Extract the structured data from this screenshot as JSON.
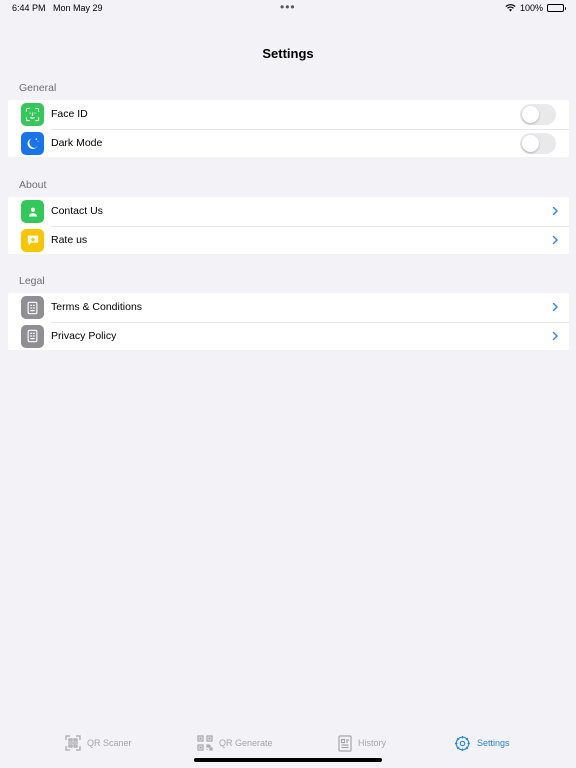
{
  "status_bar": {
    "time": "6:44 PM",
    "date": "Mon May 29",
    "battery": "100%",
    "icons": [
      "wifi-icon",
      "battery-icon"
    ]
  },
  "nav": {
    "title": "Settings"
  },
  "sections": {
    "general": {
      "header": "General",
      "items": [
        {
          "label": "Face ID",
          "icon": "face-id-icon",
          "icon_color": "#34c759",
          "control": "toggle",
          "value": "off"
        },
        {
          "label": "Dark Mode",
          "icon": "moon-icon",
          "icon_color": "#1a73e8",
          "control": "toggle",
          "value": "off"
        }
      ]
    },
    "about": {
      "header": "About",
      "items": [
        {
          "label": "Contact Us",
          "icon": "person-icon",
          "icon_color": "#34c759",
          "control": "chevron"
        },
        {
          "label": "Rate us",
          "icon": "star-bubble-icon",
          "icon_color": "#f7c600",
          "control": "chevron"
        }
      ]
    },
    "legal": {
      "header": "Legal",
      "items": [
        {
          "label": "Terms & Conditions",
          "icon": "document-icon",
          "icon_color": "#8e8e93",
          "control": "chevron"
        },
        {
          "label": "Privacy Policy",
          "icon": "document-icon",
          "icon_color": "#8e8e93",
          "control": "chevron"
        }
      ]
    }
  },
  "tab_bar": {
    "tabs": [
      {
        "label": "QR Scaner",
        "icon": "qr-scan-icon",
        "active": false
      },
      {
        "label": "QR Generate",
        "icon": "qr-code-icon",
        "active": false
      },
      {
        "label": "History",
        "icon": "history-icon",
        "active": false
      },
      {
        "label": "Settings",
        "icon": "gear-icon",
        "active": true
      }
    ]
  },
  "colors": {
    "background": "#f2f2f7",
    "accent": "#2b88d8",
    "inactive_tab": "#a5a5aa",
    "section_header": "#6d6d72"
  }
}
